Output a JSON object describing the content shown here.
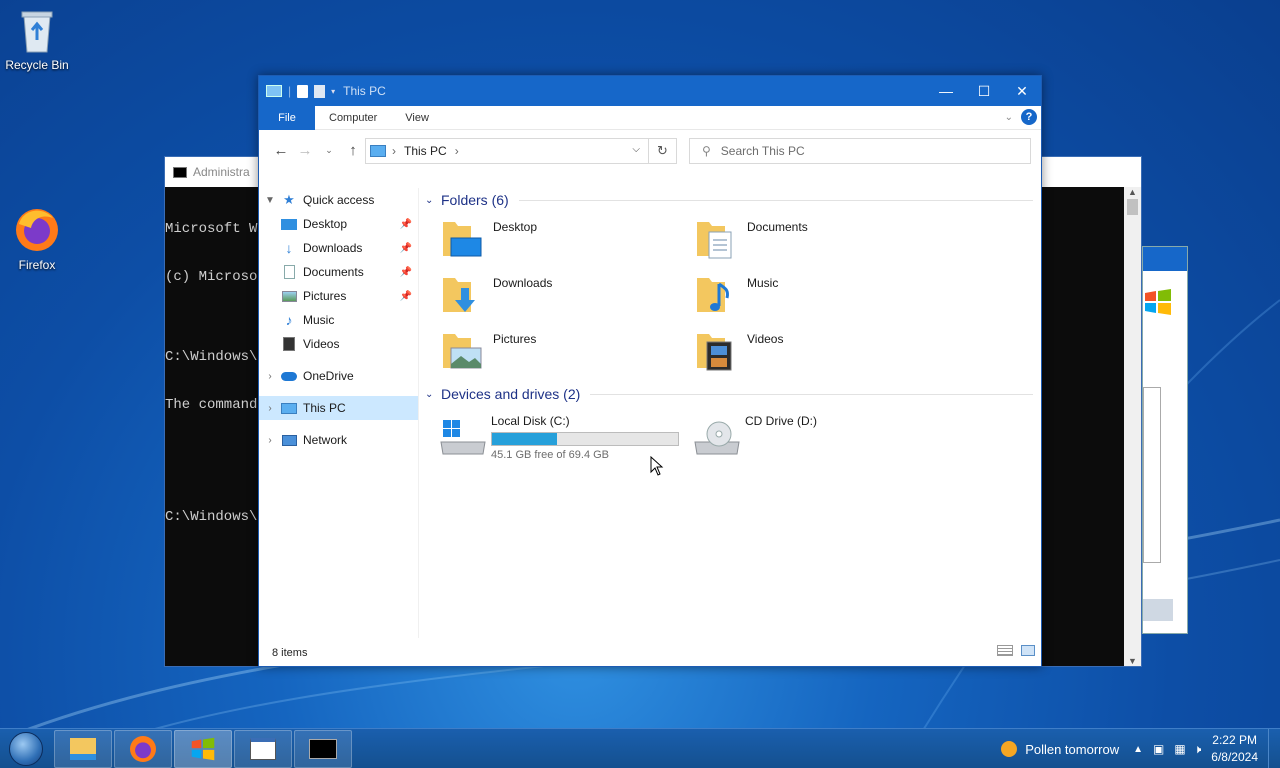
{
  "desktop": {
    "icons": [
      {
        "label": "Recycle Bin",
        "icon": "recycle-bin-icon"
      },
      {
        "label": "Firefox",
        "icon": "firefox-icon"
      }
    ]
  },
  "cmd_window": {
    "title": "Administra",
    "lines": [
      "Microsoft Wi",
      "(c) Microsof",
      "",
      "C:\\Windows\\s",
      "The command ",
      "",
      "",
      "C:\\Windows\\s"
    ]
  },
  "explorer": {
    "title": "This PC",
    "ribbon_tabs": [
      "File",
      "Computer",
      "View"
    ],
    "help_label": "?",
    "address": {
      "location": "This PC"
    },
    "search": {
      "placeholder": "Search This PC"
    },
    "nav": [
      {
        "label": "Quick access",
        "icon": "star-icon",
        "expanded": true
      },
      {
        "label": "Desktop",
        "icon": "desktop-icon",
        "pinned": true
      },
      {
        "label": "Downloads",
        "icon": "download-icon",
        "pinned": true
      },
      {
        "label": "Documents",
        "icon": "document-icon",
        "pinned": true
      },
      {
        "label": "Pictures",
        "icon": "pictures-icon",
        "pinned": true
      },
      {
        "label": "Music",
        "icon": "music-icon"
      },
      {
        "label": "Videos",
        "icon": "video-icon"
      },
      {
        "label": "OneDrive",
        "icon": "cloud-icon"
      },
      {
        "label": "This PC",
        "icon": "computer-icon",
        "selected": true
      },
      {
        "label": "Network",
        "icon": "network-icon"
      }
    ],
    "folders_header": "Folders (6)",
    "folders": [
      "Desktop",
      "Documents",
      "Downloads",
      "Music",
      "Pictures",
      "Videos"
    ],
    "devices_header": "Devices and drives (2)",
    "drives": [
      {
        "name": "Local Disk (C:)",
        "free": "45.1 GB free of 69.4 GB",
        "used_fraction": 0.35
      },
      {
        "name": "CD Drive (D:)"
      }
    ],
    "status": "8 items"
  },
  "taskbar": {
    "weather": "Pollen tomorrow",
    "time": "2:22 PM",
    "date": "6/8/2024"
  },
  "colors": {
    "accent": "#1667c9",
    "selection": "#cce8ff",
    "group_header": "#1e3287",
    "drive_fill": "#26a0da"
  }
}
